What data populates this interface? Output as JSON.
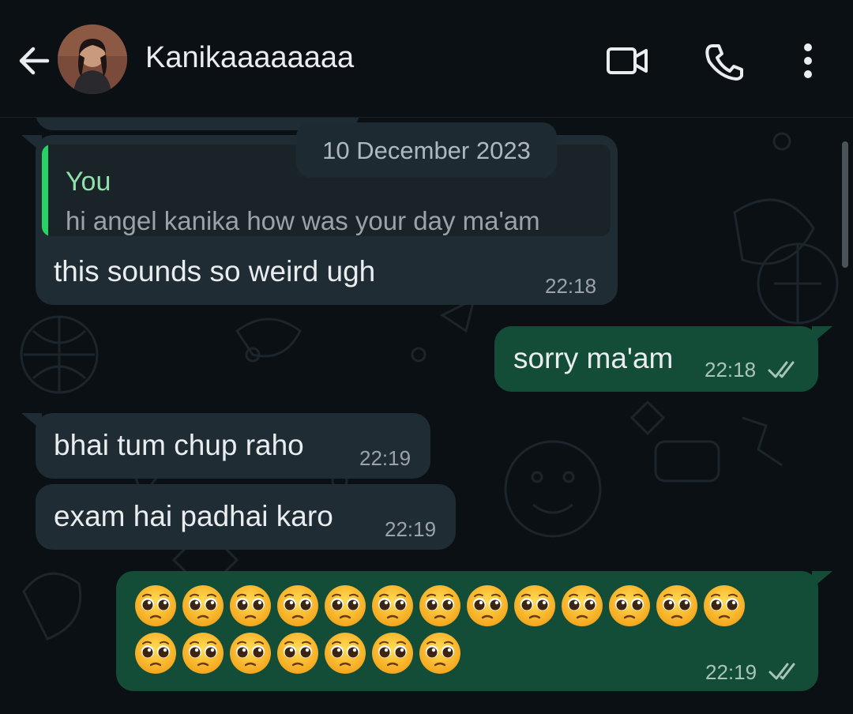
{
  "header": {
    "contact_name": "Kanikaaaaaaaa",
    "icons": [
      "back-arrow-icon",
      "avatar",
      "video-call-icon",
      "phone-icon",
      "more-options-icon"
    ]
  },
  "date_chip": "10 December 2023",
  "messages": [
    {
      "direction": "in",
      "quote_author": "You",
      "quote_text": "hi angel kanika how was your day ma'am",
      "text": "this sounds so weird ugh",
      "time": "22:18"
    },
    {
      "direction": "out",
      "text": "sorry ma'am",
      "time": "22:18",
      "status": "read"
    },
    {
      "direction": "in",
      "text": "bhai tum chup raho",
      "time": "22:19"
    },
    {
      "direction": "in",
      "text": "exam hai padhai karo",
      "time": "22:19"
    },
    {
      "direction": "out",
      "emoji": "pleading-face",
      "emoji_count": 20,
      "time": "22:19",
      "status": "read"
    }
  ],
  "colors": {
    "background": "#0b1014",
    "incoming_bubble": "#202c33",
    "outgoing_bubble": "#144d37",
    "quote_accent": "#25d366"
  }
}
